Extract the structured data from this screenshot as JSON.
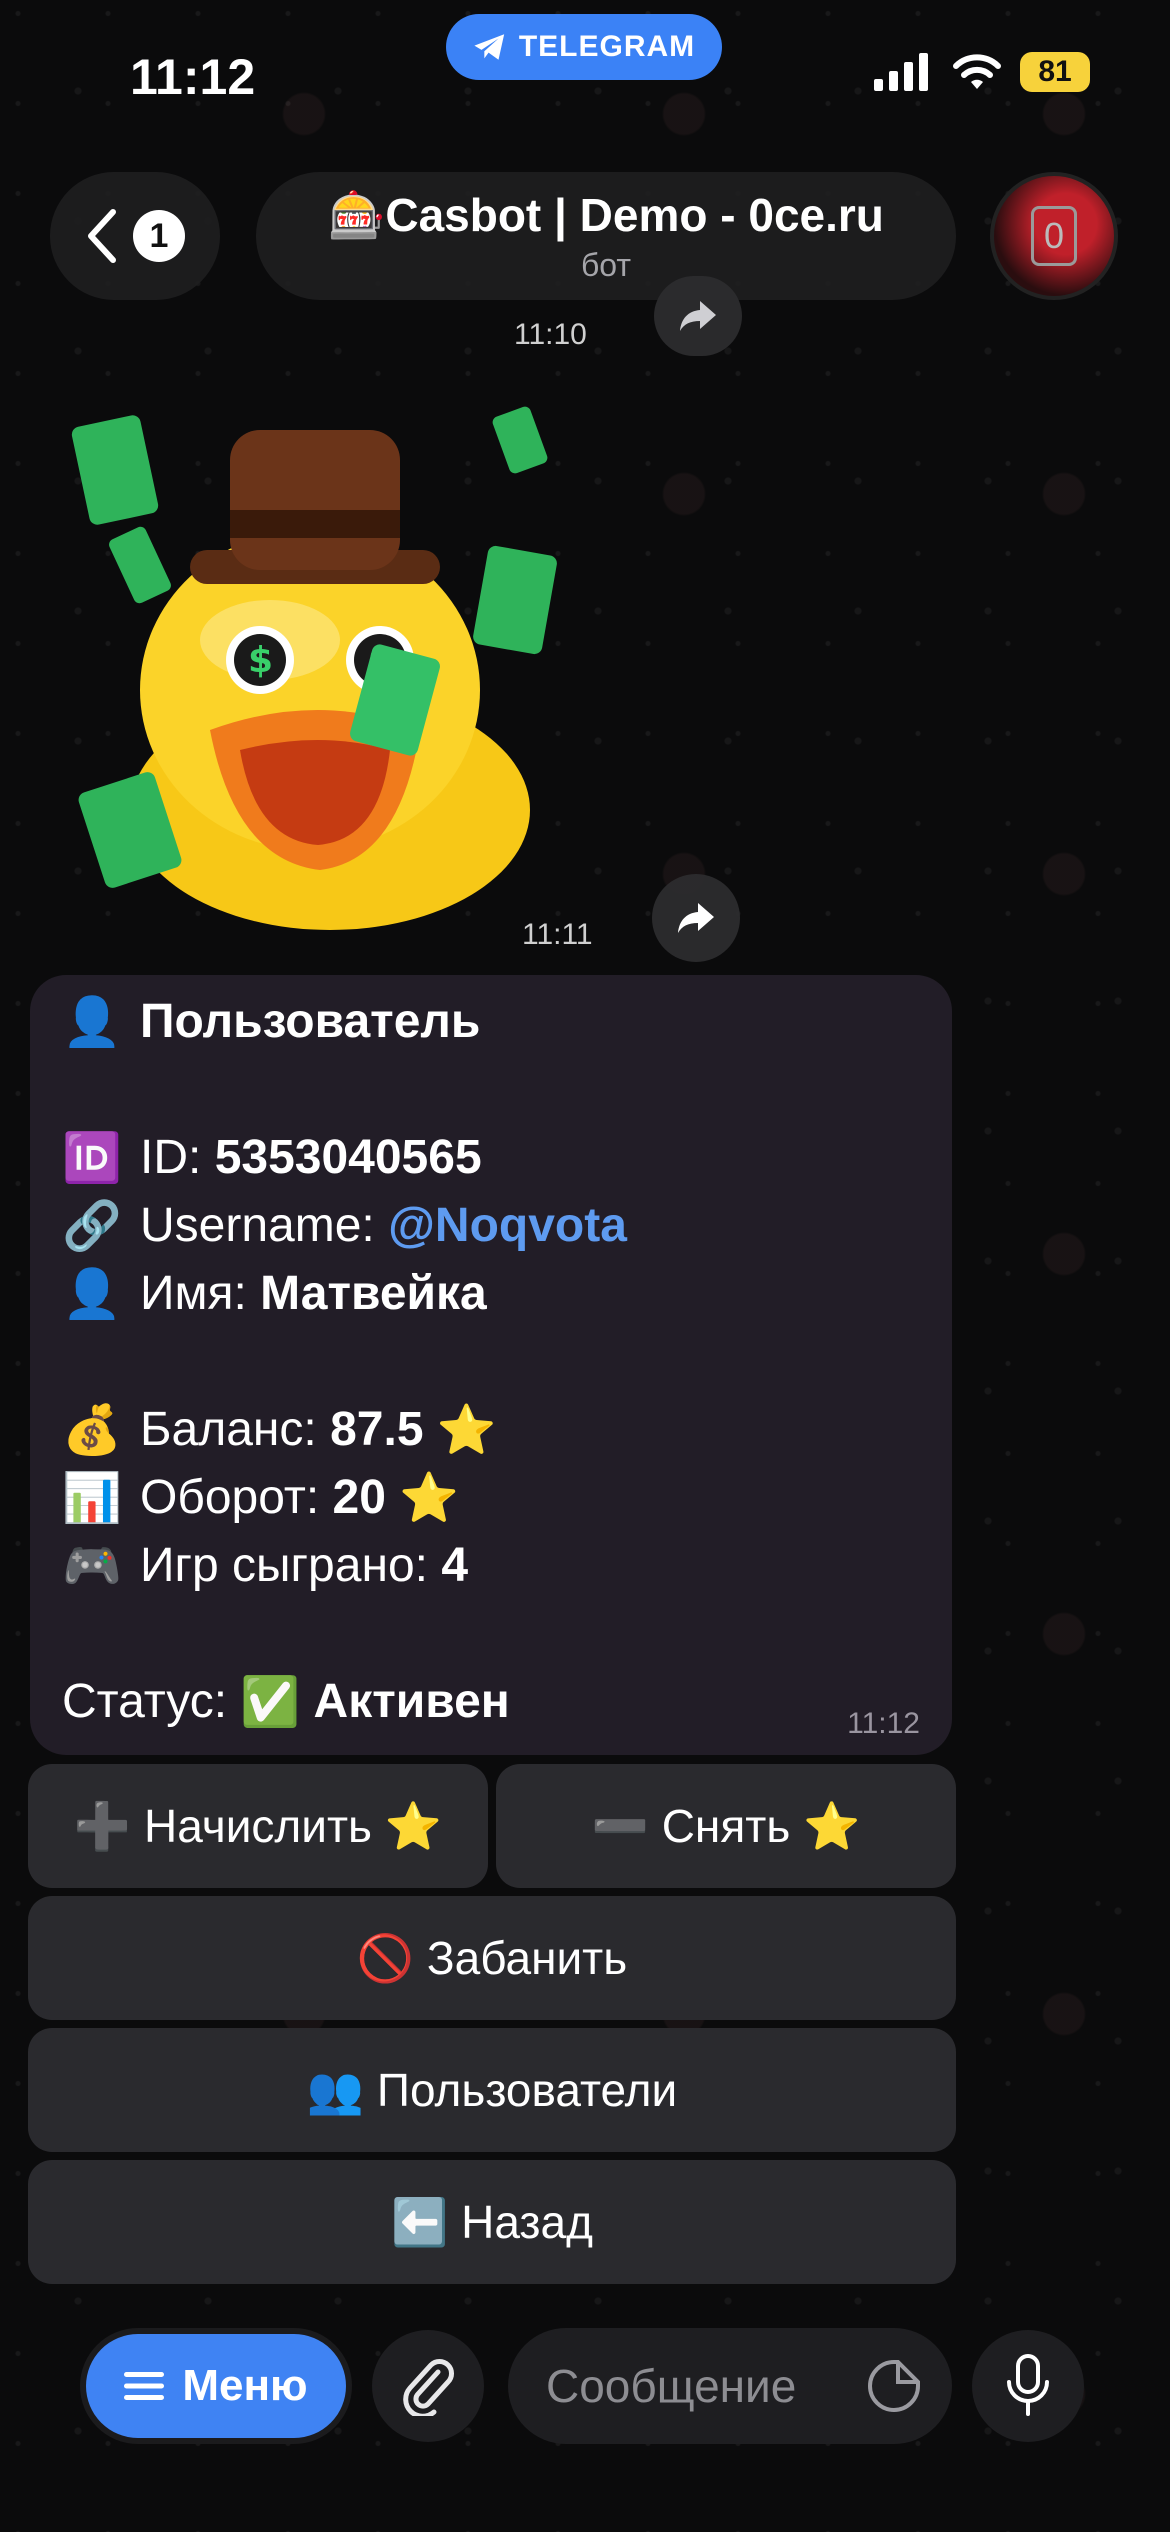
{
  "status_bar": {
    "time": "11:12",
    "source_app": "TELEGRAM",
    "battery": "81"
  },
  "header": {
    "back_badge": "1",
    "title": "🎰Casbot | Demo - 0ce.ru",
    "subtitle": "бот"
  },
  "messages": {
    "forward_time": "11:10",
    "sticker_time": "11:11",
    "card_time": "11:12"
  },
  "user_card": {
    "heading": "Пользователь",
    "id_label": "ID:",
    "id_value": "5353040565",
    "username_label": "Username:",
    "username_value": "@Noqvota",
    "name_label": "Имя:",
    "name_value": "Матвейка",
    "balance_label": "Баланс:",
    "balance_value": "87.5",
    "turnover_label": "Оборот:",
    "turnover_value": "20",
    "games_label": "Игр сыграно:",
    "games_value": "4",
    "status_label": "Статус:",
    "status_value": "Активен",
    "icons": {
      "heading": "👤",
      "id": "🆔",
      "username": "🔗",
      "name": "👤",
      "balance": "💰",
      "turnover": "📊",
      "games": "🎮",
      "status": "✅",
      "star": "⭐"
    }
  },
  "keyboard": {
    "credit": "➕ Начислить ⭐",
    "withdraw": "➖ Снять ⭐",
    "ban": "🚫 Забанить",
    "users": "👥 Пользователи",
    "back": "⬅️ Назад"
  },
  "input_bar": {
    "menu_label": "Меню",
    "placeholder": "Сообщение"
  }
}
